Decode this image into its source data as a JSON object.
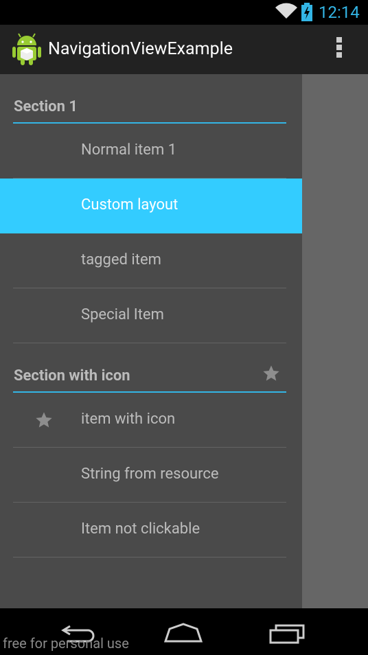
{
  "status_bar": {
    "time": "12:14",
    "accent": "#33b5e5"
  },
  "action_bar": {
    "title": "NavigationViewExample",
    "app_icon": "android-icon",
    "menu_icon": "overflow-menu-icon"
  },
  "drawer": {
    "section_1": {
      "title": "Section 1"
    },
    "items_1": [
      {
        "label": "Normal item 1",
        "active": false
      },
      {
        "label": "Custom layout",
        "active": true
      },
      {
        "label": "tagged item",
        "active": false
      },
      {
        "label": "Special Item",
        "active": false
      }
    ],
    "section_2": {
      "title": "Section with icon",
      "icon": "star-icon"
    },
    "items_2": [
      {
        "label": "item with icon",
        "icon": "star-icon"
      },
      {
        "label": "String from resource"
      },
      {
        "label": "Item not clickable"
      }
    ],
    "active_color": "#33ccff"
  },
  "nav_bar": {
    "back": "back-icon",
    "home": "home-icon",
    "recents": "recents-icon"
  },
  "watermark": "free for personal use"
}
